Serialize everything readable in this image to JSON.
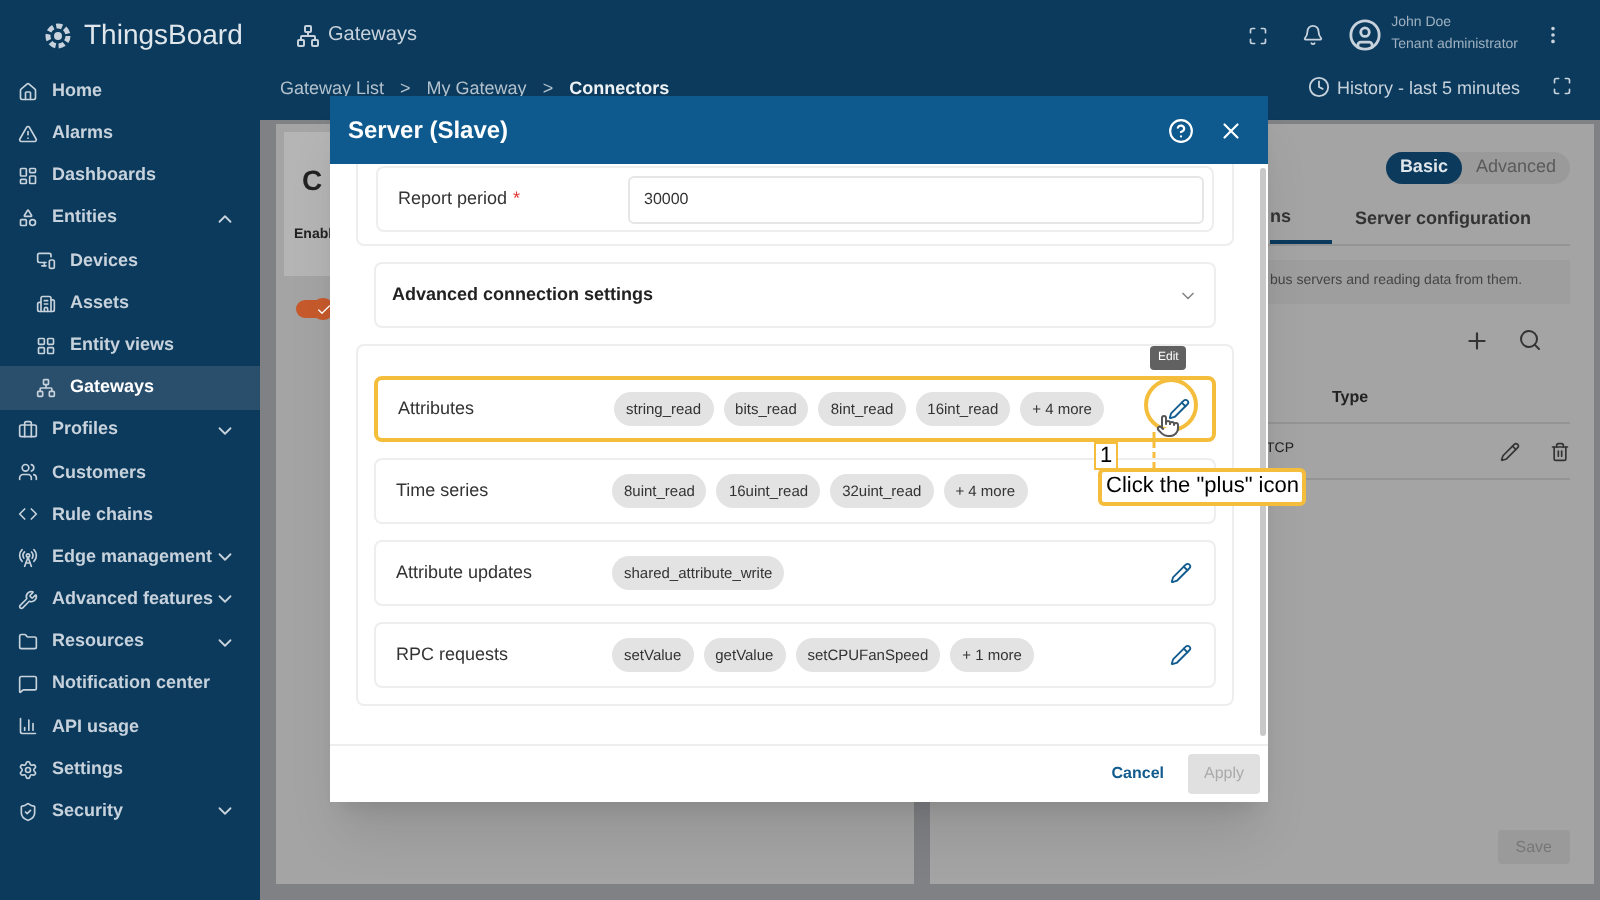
{
  "header": {
    "logo": "ThingsBoard",
    "section": "Gateways",
    "user_name": "John Doe",
    "user_role": "Tenant administrator"
  },
  "sidebar": {
    "items": [
      {
        "label": "Home",
        "kind": "link",
        "selected": false
      },
      {
        "label": "Alarms",
        "kind": "link",
        "selected": false
      },
      {
        "label": "Dashboards",
        "kind": "link",
        "selected": false
      },
      {
        "label": "Entities",
        "kind": "group",
        "expanded": true,
        "selected": false,
        "children": [
          {
            "label": "Devices",
            "selected": false
          },
          {
            "label": "Assets",
            "selected": false
          },
          {
            "label": "Entity views",
            "selected": false
          },
          {
            "label": "Gateways",
            "selected": true
          }
        ]
      },
      {
        "label": "Profiles",
        "kind": "group",
        "expanded": false,
        "selected": false
      },
      {
        "label": "Customers",
        "kind": "link",
        "selected": false
      },
      {
        "label": "Rule chains",
        "kind": "link",
        "selected": false
      },
      {
        "label": "Edge management",
        "kind": "group",
        "expanded": false,
        "selected": false
      },
      {
        "label": "Advanced features",
        "kind": "group",
        "expanded": false,
        "selected": false
      },
      {
        "label": "Resources",
        "kind": "group",
        "expanded": false,
        "selected": false
      },
      {
        "label": "Notification center",
        "kind": "link",
        "selected": false
      },
      {
        "label": "API usage",
        "kind": "link",
        "selected": false
      },
      {
        "label": "Settings",
        "kind": "link",
        "selected": false
      },
      {
        "label": "Security",
        "kind": "group",
        "expanded": false,
        "selected": false
      }
    ]
  },
  "breadcrumb": [
    {
      "text": "Gateway List",
      "kind": "link",
      "selected": false
    },
    {
      "text": ">",
      "kind": "separator"
    },
    {
      "text": "My Gateway",
      "kind": "link",
      "selected": false
    },
    {
      "text": ">",
      "kind": "separator"
    },
    {
      "text": "Connectors",
      "kind": "link",
      "selected": true
    }
  ],
  "history": "History - last 5 minutes",
  "left_card": {
    "title": "C",
    "column": "Enabl",
    "toggle_on": true
  },
  "right_card": {
    "modes": [
      {
        "label": "Basic",
        "selected": true
      },
      {
        "label": "Advanced",
        "selected": false
      }
    ],
    "tabs": [
      {
        "label": "ns",
        "selected": true
      },
      {
        "label": "Server configuration",
        "selected": false
      }
    ],
    "description": "bus servers and reading data from them.",
    "columns": [
      "Type"
    ],
    "rows": [
      {
        "type": "TCP"
      }
    ],
    "save": "Save"
  },
  "dialog": {
    "title": "Server (Slave)",
    "report_period": {
      "label": "Report period",
      "required_mark": "*",
      "value": "30000"
    },
    "advanced": {
      "label": "Advanced connection settings",
      "expanded": false
    },
    "data_rows": [
      {
        "label": "Attributes",
        "kind": "editable",
        "highlighted": true,
        "chips": [
          "string_read",
          "bits_read",
          "8int_read",
          "16int_read",
          "+ 4 more"
        ]
      },
      {
        "label": "Time series",
        "kind": "plain",
        "highlighted": false,
        "chips": [
          "8uint_read",
          "16uint_read",
          "32uint_read",
          "+ 4 more"
        ]
      },
      {
        "label": "Attribute updates",
        "kind": "editable",
        "highlighted": false,
        "chips": [
          "shared_attribute_write"
        ]
      },
      {
        "label": "RPC requests",
        "kind": "editable",
        "highlighted": false,
        "chips": [
          "setValue",
          "getValue",
          "setCPUFanSpeed",
          "+ 1 more"
        ]
      }
    ],
    "cancel": "Cancel",
    "apply": {
      "label": "Apply",
      "disabled": true
    }
  },
  "tour": {
    "tooltip": "Edit",
    "step": "1",
    "hint": "Click the \"plus\" icon"
  }
}
